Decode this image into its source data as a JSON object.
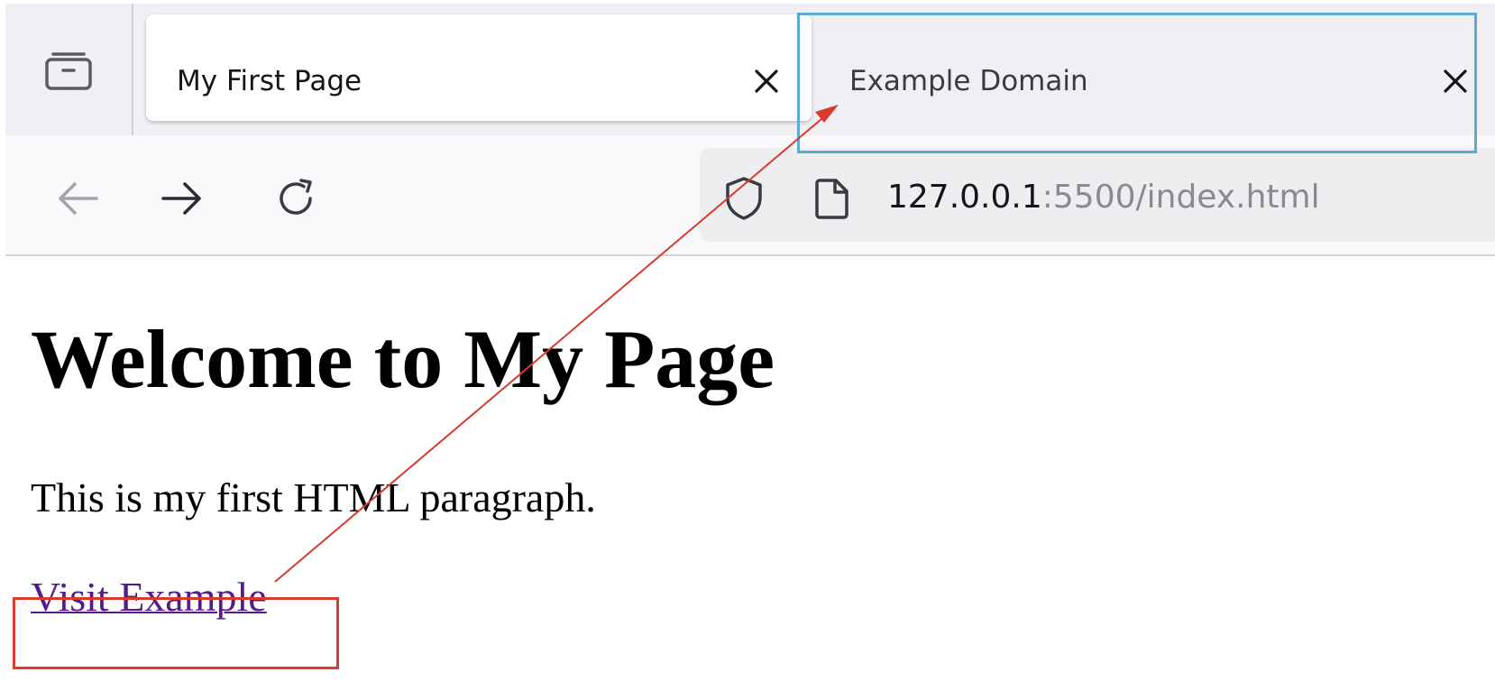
{
  "tabs": [
    {
      "title": "My First Page",
      "active": true,
      "close_icon": "close-icon"
    },
    {
      "title": "Example Domain",
      "active": false,
      "close_icon": "close-icon"
    }
  ],
  "toolbar": {
    "overview_icon": "tab-overview-icon",
    "back_icon": "arrow-left-icon",
    "forward_icon": "arrow-right-icon",
    "reload_icon": "reload-icon"
  },
  "urlbar": {
    "security_icon": "shield-icon",
    "page_icon": "page-icon",
    "host": "127.0.0.1",
    "rest": ":5500/index.html"
  },
  "page": {
    "heading": "Welcome to My Page",
    "paragraph": "This is my first HTML paragraph.",
    "link_text": "Visit Example"
  },
  "annotation": {
    "highlight_tab_color": "#5aaad5",
    "highlight_link_color": "#d93a2f",
    "arrow_color": "#d93a2f"
  },
  "colors": {
    "link_visited": "#551a8b",
    "tabstrip_bg": "#f0f0f4",
    "navbar_bg": "#f9f9fb",
    "urlbar_bg": "#eeeef1"
  }
}
